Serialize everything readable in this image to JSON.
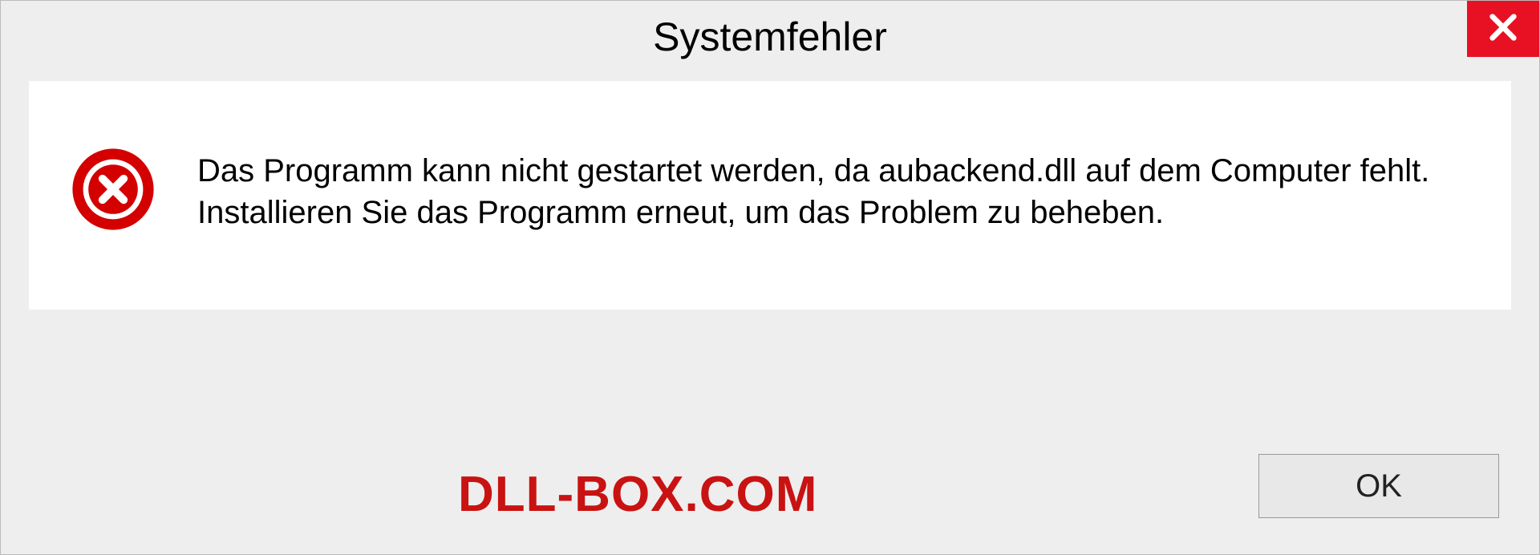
{
  "dialog": {
    "title": "Systemfehler",
    "message": "Das Programm kann nicht gestartet werden, da aubackend.dll auf dem Computer fehlt. Installieren Sie das Programm erneut, um das Problem zu beheben.",
    "ok_label": "OK"
  },
  "watermark": "DLL-BOX.COM",
  "colors": {
    "close_bg": "#e81123",
    "error_red": "#d40000",
    "watermark_red": "#c91212"
  }
}
